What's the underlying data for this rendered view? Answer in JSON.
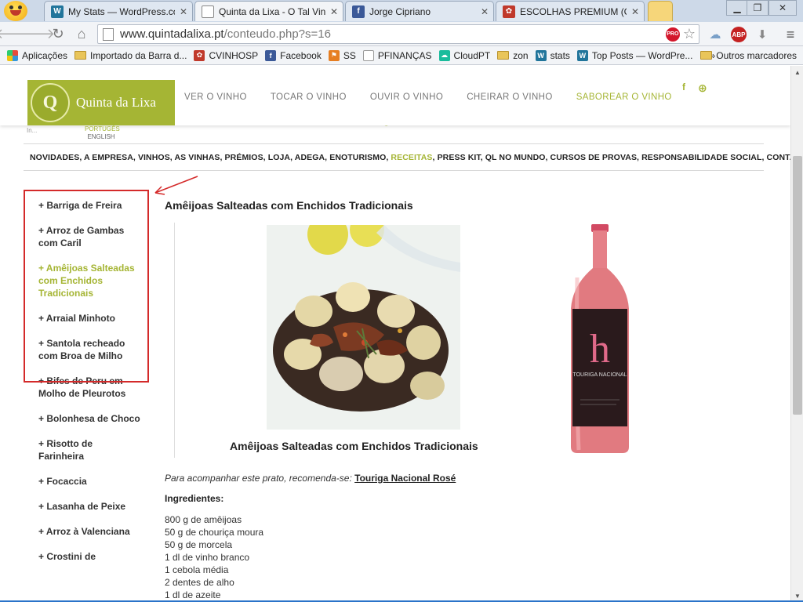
{
  "browser": {
    "tabs": [
      {
        "label": "My Stats — WordPress.com",
        "icon": "wordpress-icon",
        "active": false
      },
      {
        "label": "Quinta da Lixa - O Tal Vinho d",
        "icon": "page-icon",
        "active": true
      },
      {
        "label": "Jorge Cipriano",
        "icon": "facebook-icon",
        "active": false
      },
      {
        "label": "ESCOLHAS PREMIUM (Classif",
        "icon": "cvinhosp-icon",
        "active": false
      }
    ],
    "url": {
      "host": "www.quintadalixa.pt",
      "path": "/conteudo.php?s=16"
    },
    "bookmarks": [
      {
        "label": "Aplicações",
        "icon": "apps-icon"
      },
      {
        "label": "Importado da Barra d...",
        "icon": "folder-icon"
      },
      {
        "label": "CVINHOSP",
        "icon": "cvinhosp-icon"
      },
      {
        "label": "Facebook",
        "icon": "facebook-icon"
      },
      {
        "label": "SS",
        "icon": "ss-icon"
      },
      {
        "label": "PFINANÇAS",
        "icon": "page-icon"
      },
      {
        "label": "CloudPT",
        "icon": "cloudpt-icon"
      },
      {
        "label": "zon",
        "icon": "folder-icon"
      },
      {
        "label": "stats",
        "icon": "wordpress-icon"
      },
      {
        "label": "Top Posts — WordPre...",
        "icon": "wordpress-icon"
      }
    ],
    "bookmarks_overflow": "»",
    "other_bookmarks": "Outros marcadores"
  },
  "site": {
    "brand": "Quinta da Lixa",
    "lang_pt": "PORTUGÊS",
    "lang_en": "ENGLISH",
    "main_menu": [
      "VER O VINHO",
      "TOCAR O VINHO",
      "OUVIR O VINHO",
      "CHEIRAR O VINHO",
      "SABOREAR O VINHO"
    ],
    "main_menu_active": "SABOREAR O VINHO",
    "submenu_before": "NOVIDADES, A EMPRESA, VINHOS, AS VINHAS, PRÉMIOS, LOJA, ADEGA, ENOTURISMO, ",
    "submenu_active": "RECEITAS",
    "submenu_after": ", PRESS KIT, QL NO MUNDO, CURSOS DE PROVAS, RESPONSABILIDADE SOCIAL, CONTACTOS",
    "behind_text": "In..."
  },
  "sidebar": {
    "items": [
      {
        "label": "+ Barriga de Freira",
        "active": false
      },
      {
        "label": "+ Arroz de Gambas com Caril",
        "active": false
      },
      {
        "label": "+ Amêijoas Salteadas com Enchidos Tradicionais",
        "active": true
      },
      {
        "label": "+ Arraial Minhoto",
        "active": false
      },
      {
        "label": "+ Santola recheado com Broa de Milho",
        "active": false
      },
      {
        "label": "+ Bifes de Peru em Molho de Pleurotos",
        "active": false
      },
      {
        "label": "+ Bolonhesa de Choco",
        "active": false
      },
      {
        "label": "+ Risotto de Farinheira",
        "active": false
      },
      {
        "label": "+ Focaccia",
        "active": false
      },
      {
        "label": "+ Lasanha de Peixe",
        "active": false
      },
      {
        "label": "+ Arroz à Valenciana",
        "active": false
      },
      {
        "label": "+ Crostini de",
        "active": false
      }
    ]
  },
  "recipe": {
    "title": "Amêijoas Salteadas com Enchidos Tradicionais",
    "caption": "Amêijoas Salteadas com Enchidos Tradicionais",
    "pairing_text": "Para acompanhar este prato, recomenda-se:",
    "pairing_wine": "Touriga Nacional Rosé",
    "ingredients_heading": "Ingredientes:",
    "ingredients": [
      "800 g de amêijoas",
      "50 g de chouriça moura",
      "50 g de morcela",
      "1 dl de vinho branco",
      "1 cebola média",
      "2 dentes de alho",
      "1 dl de azeite"
    ],
    "bottle_label_brand": "h",
    "bottle_label_text": "TOURIGA NACIONAL"
  },
  "colors": {
    "accent": "#a5b534",
    "annotation": "#d42a2a",
    "wine_rose": "#e0787e"
  }
}
